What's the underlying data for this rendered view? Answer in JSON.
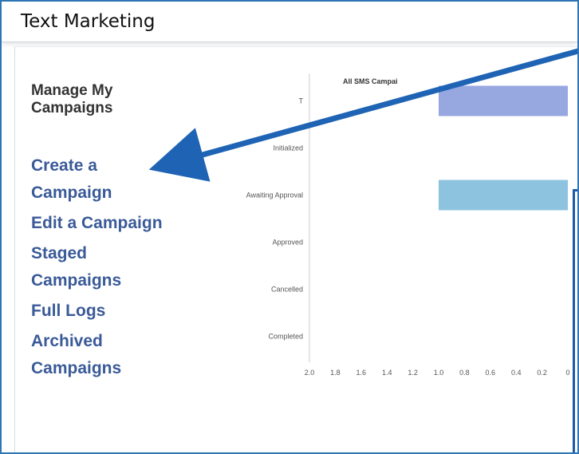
{
  "window": {
    "title": "Text Marketing"
  },
  "sidebar": {
    "heading": "Manage My Campaigns",
    "links": [
      {
        "line1": "Create a",
        "line2": "Campaign"
      },
      {
        "line1": "Edit a Campaign",
        "line2": ""
      },
      {
        "line1": "Staged",
        "line2": "Campaigns"
      },
      {
        "line1": "Full Logs",
        "line2": ""
      },
      {
        "line1": "Archived",
        "line2": "Campaigns"
      }
    ]
  },
  "chart_data": {
    "type": "bar",
    "orientation": "horizontal",
    "title": "All SMS Campai",
    "categories": [
      "T",
      "Initialized",
      "Awaiting Approval",
      "Approved",
      "Cancelled",
      "Completed"
    ],
    "values": [
      1,
      0,
      1,
      0,
      0,
      0
    ],
    "bar_colors": [
      "#97a7e0",
      "#97a7e0",
      "#8ec3e0",
      "#97a7e0",
      "#97a7e0",
      "#97a7e0"
    ],
    "xlim": [
      0,
      2.0
    ],
    "x_reversed": true,
    "x_ticks": [
      "2.0",
      "1.8",
      "1.6",
      "1.4",
      "1.2",
      "1.0",
      "0.8",
      "0.6",
      "0.4",
      "0.2",
      "0"
    ]
  },
  "annotation": {
    "arrow_color": "#1f64b4",
    "box_color": "#1f5aa8"
  }
}
